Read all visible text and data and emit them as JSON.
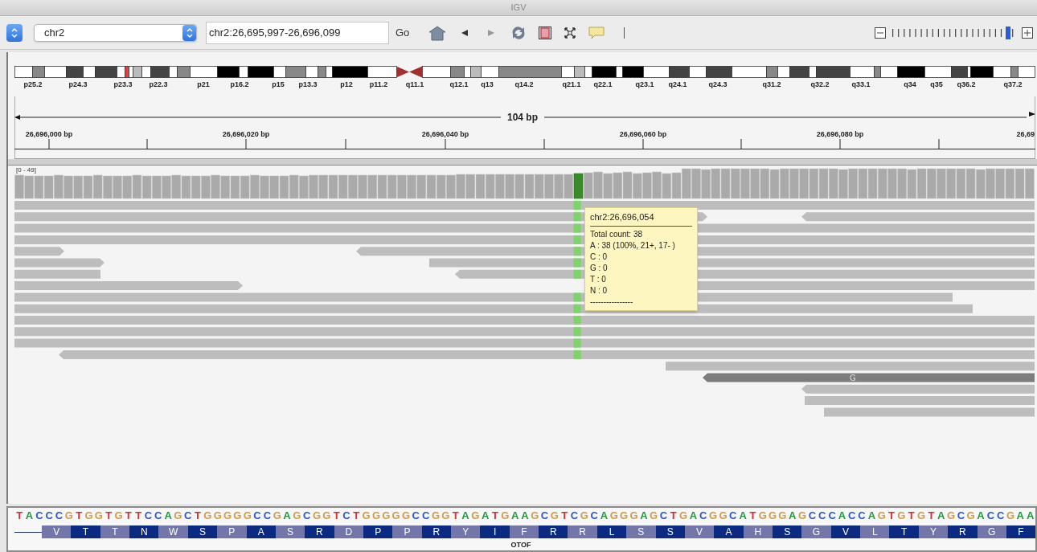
{
  "window": {
    "title": "IGV"
  },
  "toolbar": {
    "chromosome": "chr2",
    "locus": "chr2:26,695,997-26,696,099",
    "go": "Go",
    "zoom": {
      "level": 0.95
    }
  },
  "ideogram": {
    "bands": [
      "p25.2",
      "p24.3",
      "p23.3",
      "p22.3",
      "p21",
      "p16.2",
      "p15",
      "p13.3",
      "p12",
      "p11.2",
      "q11.1",
      "q12.1",
      "q13",
      "q14.2",
      "q21.1",
      "q22.1",
      "q23.1",
      "q24.1",
      "q24.3",
      "q31.2",
      "q32.2",
      "q33.1",
      "q34",
      "q35",
      "q36.2",
      "q37.2"
    ]
  },
  "ruler": {
    "span": "104 bp",
    "ticks": [
      "26,696,000 bp",
      "26,696,020 bp",
      "26,696,040 bp",
      "26,696,060 bp",
      "26,696,080 bp",
      "26,69"
    ]
  },
  "coverage_track": {
    "range": "[0 - 49]"
  },
  "alignments": {
    "mismatch_base": "G"
  },
  "tooltip": {
    "title": "chr2:26,696,054",
    "lines": [
      "Total count: 38",
      "A : 38 (100%, 21+, 17- )",
      "C : 0",
      "G : 0",
      "T : 0",
      "N : 0",
      "----------------"
    ]
  },
  "sequence": {
    "bases": [
      {
        "base": "T",
        "color": "#dd2b2b"
      },
      {
        "base": "A",
        "color": "#1f9a3c"
      },
      {
        "base": "C",
        "color": "#2a56d6"
      },
      {
        "base": "C",
        "color": "#2a56d6"
      },
      {
        "base": "C",
        "color": "#2a56d6"
      },
      {
        "base": "G",
        "color": "#d39a44"
      },
      {
        "base": "T",
        "color": "#dd2b2b"
      },
      {
        "base": "G",
        "color": "#d39a44"
      },
      {
        "base": "G",
        "color": "#d39a44"
      },
      {
        "base": "T",
        "color": "#dd2b2b"
      },
      {
        "base": "G",
        "color": "#d39a44"
      },
      {
        "base": "T",
        "color": "#dd2b2b"
      },
      {
        "base": "T",
        "color": "#dd2b2b"
      },
      {
        "base": "C",
        "color": "#2a56d6"
      },
      {
        "base": "C",
        "color": "#2a56d6"
      },
      {
        "base": "A",
        "color": "#1f9a3c"
      },
      {
        "base": "G",
        "color": "#d39a44"
      },
      {
        "base": "C",
        "color": "#2a56d6"
      },
      {
        "base": "T",
        "color": "#dd2b2b"
      },
      {
        "base": "G",
        "color": "#d39a44"
      },
      {
        "base": "G",
        "color": "#d39a44"
      },
      {
        "base": "G",
        "color": "#d39a44"
      },
      {
        "base": "G",
        "color": "#d39a44"
      },
      {
        "base": "G",
        "color": "#d39a44"
      },
      {
        "base": "C",
        "color": "#2a56d6"
      },
      {
        "base": "C",
        "color": "#2a56d6"
      },
      {
        "base": "G",
        "color": "#d39a44"
      },
      {
        "base": "A",
        "color": "#1f9a3c"
      },
      {
        "base": "G",
        "color": "#d39a44"
      },
      {
        "base": "C",
        "color": "#2a56d6"
      },
      {
        "base": "G",
        "color": "#d39a44"
      },
      {
        "base": "G",
        "color": "#d39a44"
      },
      {
        "base": "T",
        "color": "#dd2b2b"
      },
      {
        "base": "C",
        "color": "#2a56d6"
      },
      {
        "base": "T",
        "color": "#dd2b2b"
      },
      {
        "base": "G",
        "color": "#d39a44"
      },
      {
        "base": "G",
        "color": "#d39a44"
      },
      {
        "base": "G",
        "color": "#d39a44"
      },
      {
        "base": "G",
        "color": "#d39a44"
      },
      {
        "base": "G",
        "color": "#d39a44"
      },
      {
        "base": "C",
        "color": "#2a56d6"
      },
      {
        "base": "C",
        "color": "#2a56d6"
      },
      {
        "base": "G",
        "color": "#d39a44"
      },
      {
        "base": "G",
        "color": "#d39a44"
      },
      {
        "base": "T",
        "color": "#dd2b2b"
      },
      {
        "base": "A",
        "color": "#1f9a3c"
      },
      {
        "base": "G",
        "color": "#d39a44"
      },
      {
        "base": "A",
        "color": "#1f9a3c"
      },
      {
        "base": "T",
        "color": "#dd2b2b"
      },
      {
        "base": "G",
        "color": "#d39a44"
      },
      {
        "base": "A",
        "color": "#1f9a3c"
      },
      {
        "base": "A",
        "color": "#1f9a3c"
      },
      {
        "base": "G",
        "color": "#d39a44"
      },
      {
        "base": "C",
        "color": "#2a56d6"
      },
      {
        "base": "G",
        "color": "#d39a44"
      },
      {
        "base": "T",
        "color": "#dd2b2b"
      },
      {
        "base": "C",
        "color": "#2a56d6"
      },
      {
        "base": "G",
        "color": "#d39a44"
      },
      {
        "base": "C",
        "color": "#2a56d6"
      },
      {
        "base": "A",
        "color": "#1f9a3c"
      },
      {
        "base": "G",
        "color": "#d39a44"
      },
      {
        "base": "G",
        "color": "#d39a44"
      },
      {
        "base": "G",
        "color": "#d39a44"
      },
      {
        "base": "A",
        "color": "#1f9a3c"
      },
      {
        "base": "G",
        "color": "#d39a44"
      },
      {
        "base": "C",
        "color": "#2a56d6"
      },
      {
        "base": "T",
        "color": "#dd2b2b"
      },
      {
        "base": "G",
        "color": "#d39a44"
      },
      {
        "base": "A",
        "color": "#1f9a3c"
      },
      {
        "base": "C",
        "color": "#2a56d6"
      },
      {
        "base": "G",
        "color": "#d39a44"
      },
      {
        "base": "G",
        "color": "#d39a44"
      },
      {
        "base": "C",
        "color": "#2a56d6"
      },
      {
        "base": "A",
        "color": "#1f9a3c"
      },
      {
        "base": "T",
        "color": "#dd2b2b"
      },
      {
        "base": "G",
        "color": "#d39a44"
      },
      {
        "base": "G",
        "color": "#d39a44"
      },
      {
        "base": "G",
        "color": "#d39a44"
      },
      {
        "base": "A",
        "color": "#1f9a3c"
      },
      {
        "base": "G",
        "color": "#d39a44"
      },
      {
        "base": "C",
        "color": "#2a56d6"
      },
      {
        "base": "C",
        "color": "#2a56d6"
      },
      {
        "base": "C",
        "color": "#2a56d6"
      },
      {
        "base": "A",
        "color": "#1f9a3c"
      },
      {
        "base": "C",
        "color": "#2a56d6"
      },
      {
        "base": "C",
        "color": "#2a56d6"
      },
      {
        "base": "A",
        "color": "#1f9a3c"
      },
      {
        "base": "G",
        "color": "#d39a44"
      },
      {
        "base": "T",
        "color": "#dd2b2b"
      },
      {
        "base": "G",
        "color": "#d39a44"
      },
      {
        "base": "T",
        "color": "#dd2b2b"
      },
      {
        "base": "G",
        "color": "#d39a44"
      },
      {
        "base": "T",
        "color": "#dd2b2b"
      },
      {
        "base": "A",
        "color": "#1f9a3c"
      },
      {
        "base": "G",
        "color": "#d39a44"
      },
      {
        "base": "C",
        "color": "#2a56d6"
      },
      {
        "base": "G",
        "color": "#d39a44"
      },
      {
        "base": "A",
        "color": "#1f9a3c"
      },
      {
        "base": "C",
        "color": "#2a56d6"
      },
      {
        "base": "C",
        "color": "#2a56d6"
      },
      {
        "base": "G",
        "color": "#d39a44"
      },
      {
        "base": "A",
        "color": "#1f9a3c"
      },
      {
        "base": "A",
        "color": "#1f9a3c"
      }
    ],
    "amino_acids": [
      "V",
      "T",
      "T",
      "N",
      "W",
      "S",
      "P",
      "A",
      "S",
      "R",
      "D",
      "P",
      "P",
      "R",
      "Y",
      "I",
      "F",
      "R",
      "R",
      "L",
      "S",
      "S",
      "V",
      "A",
      "H",
      "S",
      "G",
      "V",
      "L",
      "T",
      "Y",
      "R",
      "G",
      "F"
    ],
    "gene": "OTOF"
  }
}
